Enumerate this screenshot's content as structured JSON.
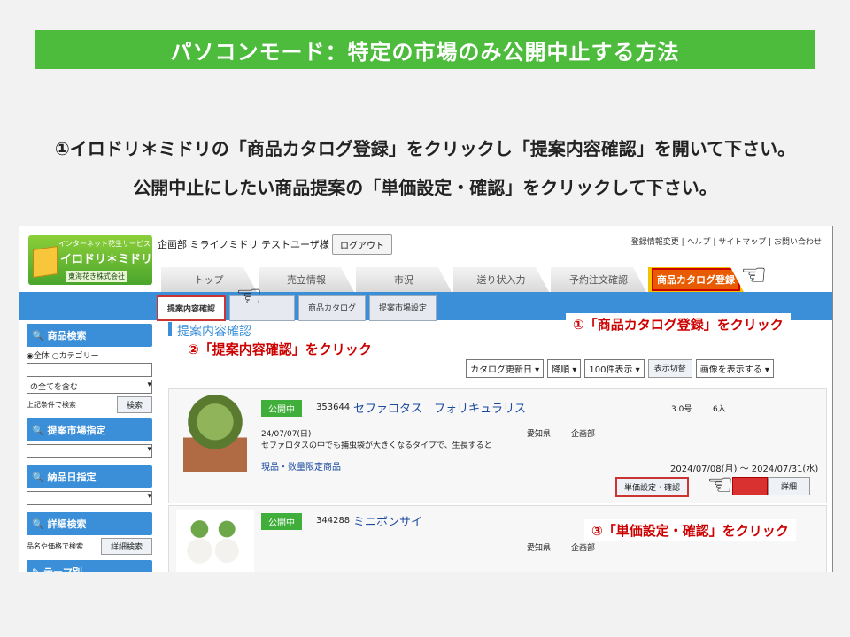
{
  "banner": {
    "title": "パソコンモード：特定の市場のみ公開中止する方法"
  },
  "instructions": {
    "line1": "①イロドリ＊ミドリの「商品カタログ登録」をクリックし「提案内容確認」を開いて下さい。",
    "line2": "公開中止にしたい商品提案の「単価設定・確認」をクリックして下さい。"
  },
  "screenshot": {
    "logo": {
      "tagline": "インターネット花生サービス",
      "name": "イロドリ＊ミドリ",
      "company": "東海花き株式会社"
    },
    "user_label": "企画部 ミライノミドリ テストユーザ様",
    "logout_label": "ログアウト",
    "top_links": "登録情報変更 | ヘルプ | サイトマップ | お問い合わせ",
    "main_tabs": [
      "トップ",
      "売立情報",
      "市況",
      "送り状入力",
      "予約注文確認",
      "商品カタログ登録"
    ],
    "sub_tabs": [
      "提案内容確認",
      "",
      "商品カタログ",
      "提案市場設定"
    ],
    "page_heading": "提案内容確認",
    "sidebar": {
      "product_search": "商品検索",
      "radio_all": "全体",
      "radio_category": "カテゴリー",
      "match_select": "の全てを含む",
      "note": "上記条件で検索",
      "search_button": "検索",
      "market_spec": "提案市場指定",
      "delivery_spec": "納品日指定",
      "detail_search": "詳細検索",
      "detail_note": "品名や価格で検索",
      "detail_button": "詳細検索",
      "theme": "テーマ別"
    },
    "controls": {
      "sort": "カタログ更新日",
      "order": "降順",
      "per_page": "100件表示",
      "toggle": "表示切替",
      "image": "画像を表示する"
    },
    "products": [
      {
        "status": "公開中",
        "id": "353644",
        "name": "セファロタス　フォリキュラリス",
        "size": "3.0号",
        "qty": "6入",
        "date": "24/07/07(日)",
        "description": "セファロタスの中でも捕虫袋が大きくなるタイプで、生長すると",
        "pref": "愛知県",
        "dept": "企画部",
        "limited": "現品・数量限定商品",
        "period": "2024/07/08(月) ～ 2024/07/31(水)",
        "price_button": "単価設定・確認",
        "detail_button": "詳細"
      },
      {
        "status": "公開中",
        "id": "344288",
        "name": "ミニボンサイ",
        "pref": "愛知県",
        "dept": "企画部"
      }
    ],
    "callouts": {
      "c1": "①「商品カタログ登録」をクリック",
      "c2": "②「提案内容確認」をクリック",
      "c3": "③「単価設定・確認」をクリック"
    },
    "hand_glyph": "☜"
  }
}
